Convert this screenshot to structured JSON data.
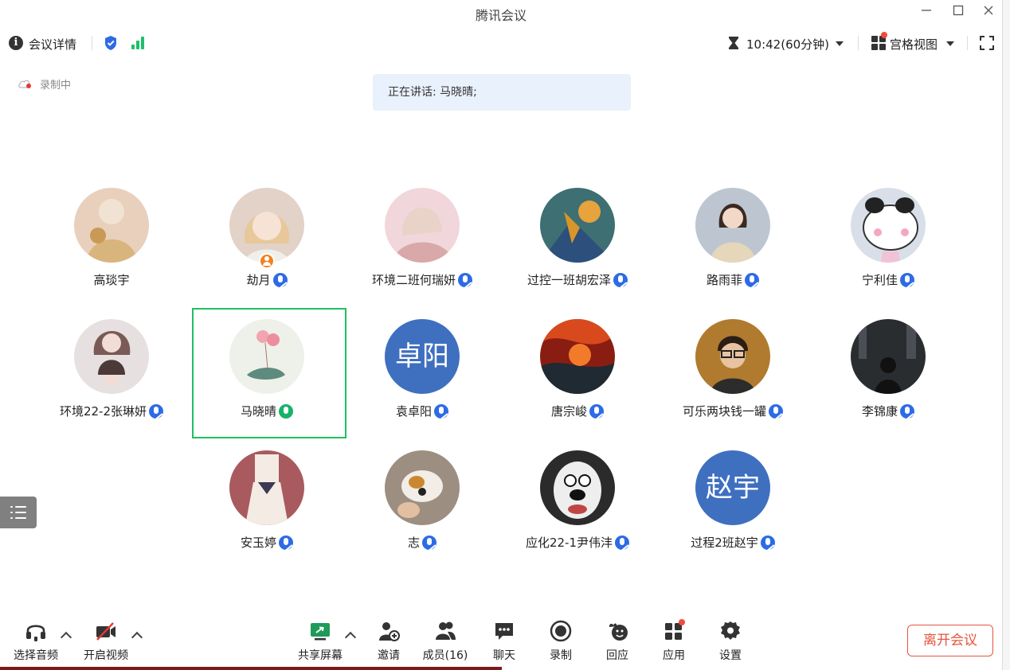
{
  "window": {
    "title": "腾讯会议",
    "minimize_icon": "minimize-icon",
    "maximize_icon": "maximize-icon",
    "close_icon": "close-icon"
  },
  "topbar": {
    "meeting_details": "会议详情",
    "timer": "10:42(60分钟)",
    "view_mode": "宫格视图",
    "security_color": "#2d6be6",
    "signal_color": "#1ec06b"
  },
  "status": {
    "recording": "录制中",
    "speaking": "正在讲话: 马晓晴;"
  },
  "participants": [
    {
      "name": "高琰宇",
      "avatar": "photo",
      "mic": false
    },
    {
      "name": "劫月",
      "avatar": "photo",
      "mic": true,
      "host": true
    },
    {
      "name": "环境二班何瑞妍",
      "avatar": "photo",
      "mic": true
    },
    {
      "name": "过控一班胡宏泽",
      "avatar": "photo",
      "mic": true
    },
    {
      "name": "路雨菲",
      "avatar": "photo",
      "mic": true
    },
    {
      "name": "宁利佳",
      "avatar": "photo",
      "mic": true
    },
    {
      "name": "环境22-2张琳妍",
      "avatar": "photo",
      "mic": true
    },
    {
      "name": "马晓晴",
      "avatar": "photo",
      "mic": true,
      "speaking": true
    },
    {
      "name": "袁卓阳",
      "avatar": "卓阳",
      "mic": true
    },
    {
      "name": "唐宗峻",
      "avatar": "photo",
      "mic": true
    },
    {
      "name": "可乐两块钱一罐",
      "avatar": "photo",
      "mic": true
    },
    {
      "name": "李锦康",
      "avatar": "photo",
      "mic": true
    },
    {
      "name": "安玉婷",
      "avatar": "photo",
      "mic": true
    },
    {
      "name": "志",
      "avatar": "photo",
      "mic": true
    },
    {
      "name": "应化22-1尹伟沣",
      "avatar": "photo",
      "mic": true
    },
    {
      "name": "过程2班赵宇",
      "avatar": "赵宇",
      "mic": true
    }
  ],
  "toolbar": {
    "audio": "选择音频",
    "video": "开启视频",
    "share": "共享屏幕",
    "invite": "邀请",
    "members": "成员(16)",
    "chat": "聊天",
    "record": "录制",
    "react": "回应",
    "apps": "应用",
    "settings": "设置",
    "leave": "离开会议"
  },
  "colors": {
    "accent": "#2d6be6",
    "active_speaker": "#20c060",
    "leave": "#e5543f",
    "speaking_bg": "#e9f1fc"
  }
}
